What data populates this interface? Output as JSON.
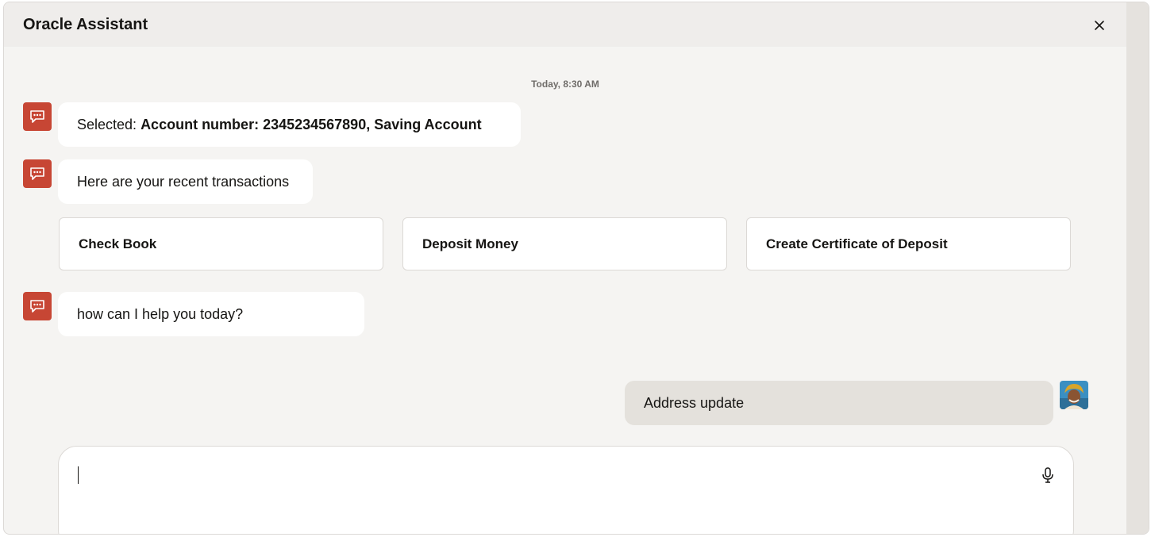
{
  "header": {
    "title": "Oracle Assistant",
    "close_icon": "close-icon"
  },
  "conversation": {
    "timestamp": "Today, 8:30 AM",
    "messages": [
      {
        "from": "bot",
        "prefix": "Selected: ",
        "emphasis": "Account number: 2345234567890, Saving Account"
      },
      {
        "from": "bot",
        "text": "Here are your recent transactions"
      },
      {
        "from": "bot",
        "text": "how can I help you today?"
      },
      {
        "from": "user",
        "text": "Address update"
      }
    ],
    "actions": [
      {
        "label": "Check Book"
      },
      {
        "label": "Deposit Money"
      },
      {
        "label": "Create Certificate of Deposit"
      }
    ]
  },
  "composer": {
    "value": "",
    "placeholder": "",
    "mic_icon": "microphone-icon"
  },
  "colors": {
    "bot_icon": "#c74634",
    "user_bubble": "#e4e1dc",
    "panel_bg": "#f5f4f2"
  }
}
